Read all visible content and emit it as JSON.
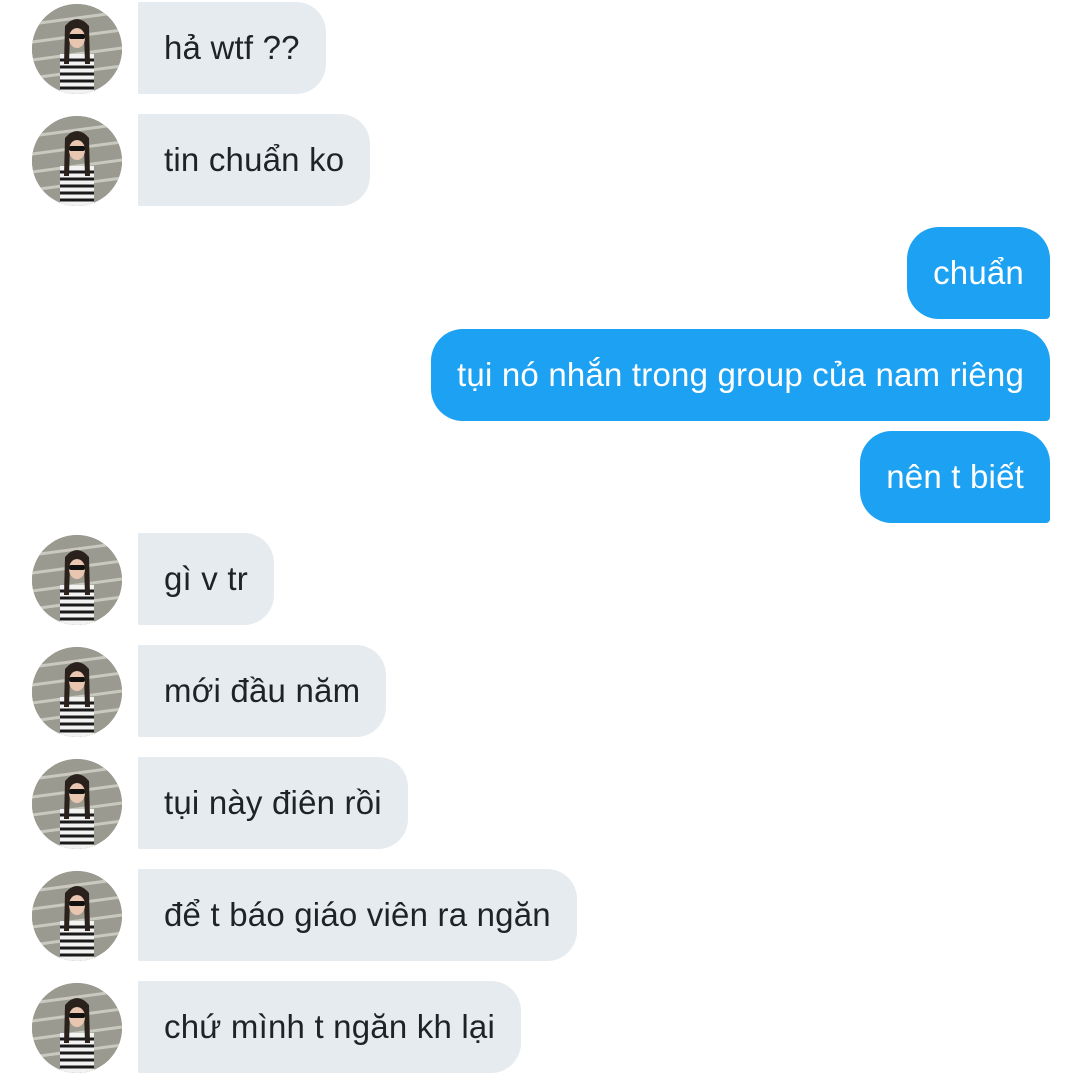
{
  "theme": {
    "incoming_bubble_color": "#e6ebef",
    "outgoing_bubble_color": "#1da1f2",
    "incoming_text_color": "#1e2327",
    "outgoing_text_color": "#ffffff"
  },
  "messages": [
    {
      "sender": "other",
      "text": "hả wtf ??",
      "avatar": "contact-avatar"
    },
    {
      "sender": "other",
      "text": "tin chuẩn ko",
      "avatar": "contact-avatar"
    },
    {
      "sender": "me",
      "text": "chuẩn"
    },
    {
      "sender": "me",
      "text": "tụi nó nhắn trong group của nam riêng"
    },
    {
      "sender": "me",
      "text": "nên t biết"
    },
    {
      "sender": "other",
      "text": "gì v tr",
      "avatar": "contact-avatar"
    },
    {
      "sender": "other",
      "text": "mới đầu năm",
      "avatar": "contact-avatar"
    },
    {
      "sender": "other",
      "text": "tụi này điên rồi",
      "avatar": "contact-avatar"
    },
    {
      "sender": "other",
      "text": "để t báo giáo viên ra ngăn",
      "avatar": "contact-avatar"
    },
    {
      "sender": "other",
      "text": "chứ mình t ngăn kh lại",
      "avatar": "contact-avatar"
    }
  ]
}
